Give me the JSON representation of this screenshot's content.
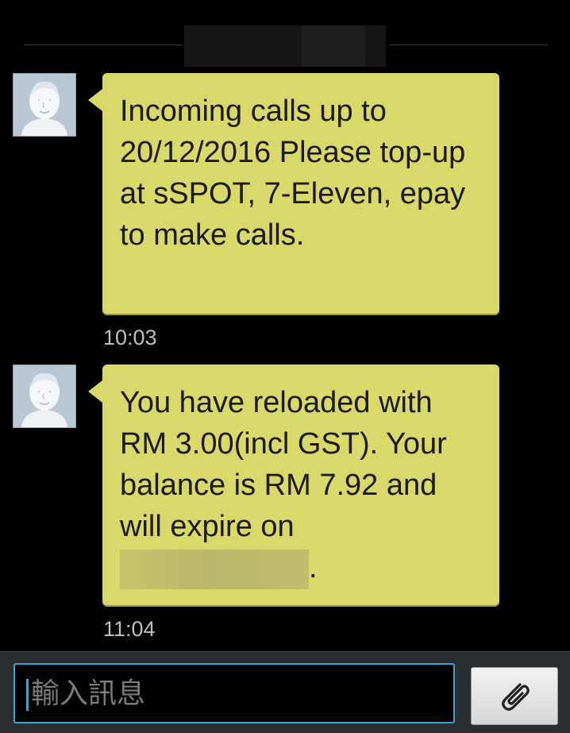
{
  "header": {
    "date_redacted": true
  },
  "messages": [
    {
      "sender_avatar": "default-contact-icon",
      "text": "Incoming calls up to 20/12/2016 Please top-up at sSPOT, 7-Eleven, epay to make calls.",
      "time": "10:03"
    },
    {
      "sender_avatar": "default-contact-icon",
      "text": "You have reloaded with RM 3.00(incl GST). Your balance is RM 7.92 and will expire on",
      "text_end": ".",
      "time": "11:04"
    }
  ],
  "composer": {
    "placeholder": "輸入訊息",
    "value": "",
    "attach_icon": "paperclip-icon"
  },
  "colors": {
    "bubble": "#d9d86a",
    "background": "#000000",
    "accent": "#2fa7d8"
  }
}
